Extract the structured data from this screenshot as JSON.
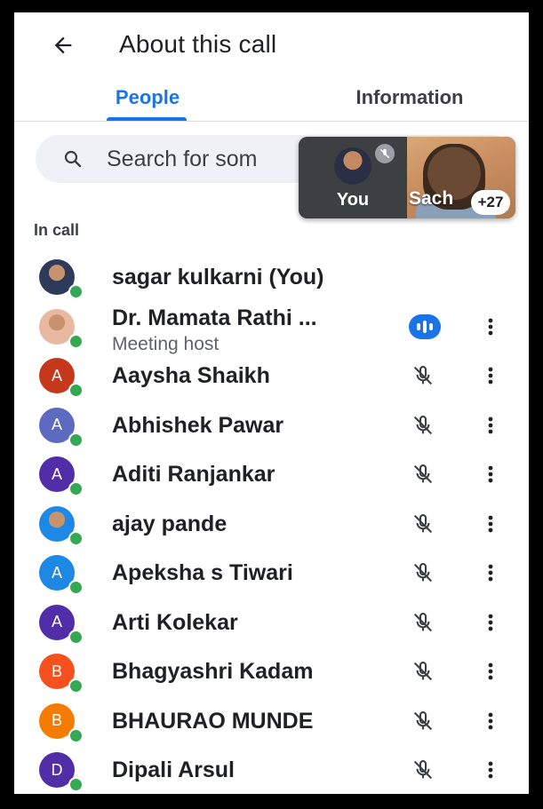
{
  "header": {
    "title": "About this call",
    "back_icon": "arrow-left-icon"
  },
  "tabs": [
    {
      "label": "People",
      "active": true
    },
    {
      "label": "Information",
      "active": false
    }
  ],
  "colors": {
    "accent": "#1a73e8",
    "online": "#34a853"
  },
  "search": {
    "placeholder_visible": "Search for som"
  },
  "pip": {
    "self_label": "You",
    "other_label": "Sach",
    "extra_count": "+27"
  },
  "section_label": "In call",
  "participants": [
    {
      "name": "sagar kulkarni (You)",
      "initial": "",
      "avatar": "photo",
      "color": "#2d3a5a",
      "status": "none"
    },
    {
      "name": "Dr. Mamata Rathi ...",
      "subtitle": "Meeting host",
      "initial": "",
      "avatar": "photo",
      "color": "#e8b8a0",
      "status": "speaking"
    },
    {
      "name": "Aaysha Shaikh",
      "initial": "A",
      "avatar": "letter",
      "color": "#c5381b",
      "status": "muted"
    },
    {
      "name": "Abhishek Pawar",
      "initial": "A",
      "avatar": "letter",
      "color": "#5c6bc0",
      "status": "muted"
    },
    {
      "name": "Aditi Ranjankar",
      "initial": "A",
      "avatar": "letter",
      "color": "#512da8",
      "status": "muted"
    },
    {
      "name": "ajay pande",
      "initial": "",
      "avatar": "photo",
      "color": "#1e88e5",
      "status": "muted"
    },
    {
      "name": "Apeksha s Tiwari",
      "initial": "A",
      "avatar": "letter",
      "color": "#1e88e5",
      "status": "muted"
    },
    {
      "name": "Arti Kolekar",
      "initial": "A",
      "avatar": "letter",
      "color": "#512da8",
      "status": "muted"
    },
    {
      "name": "Bhagyashri Kadam",
      "initial": "B",
      "avatar": "letter",
      "color": "#f4511e",
      "status": "muted"
    },
    {
      "name": "BHAURAO MUNDE",
      "initial": "B",
      "avatar": "letter",
      "color": "#f57c00",
      "status": "muted"
    },
    {
      "name": "Dipali Arsul",
      "initial": "D",
      "avatar": "letter",
      "color": "#512da8",
      "status": "muted"
    }
  ]
}
